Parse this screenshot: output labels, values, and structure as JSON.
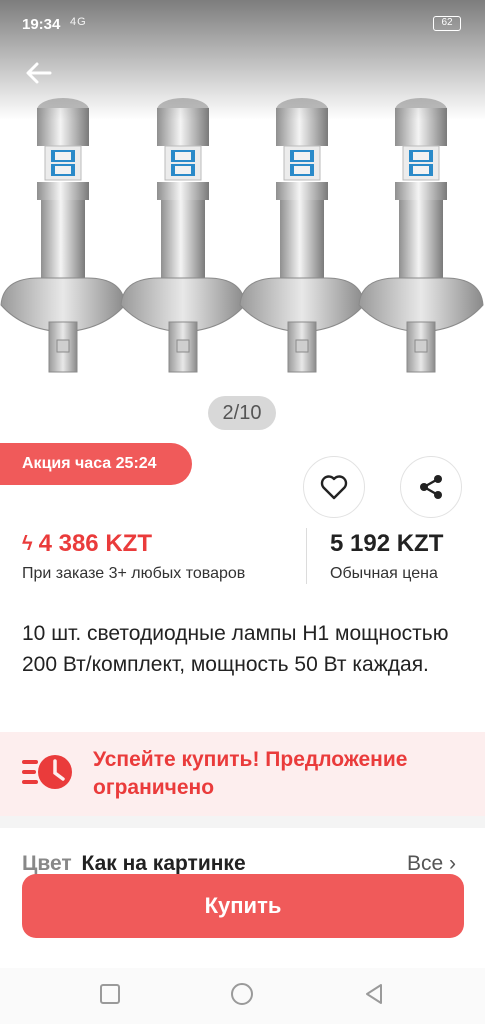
{
  "status_bar": {
    "time": "19:34",
    "signal": "4G",
    "battery": "62"
  },
  "gallery": {
    "page_indicator": "2/10"
  },
  "promo": {
    "badge": "Акция часа 25:24"
  },
  "prices": {
    "promo_price": "4 386 KZT",
    "promo_note": "При заказе 3+ любых товаров",
    "regular_price": "5 192 KZT",
    "regular_note": "Обычная цена"
  },
  "product": {
    "title": "10 шт. светодиодные лампы H1 мощностью 200 Вт/комплект, мощность 50 Вт каждая."
  },
  "urgency": {
    "text": "Успейте купить! Предложение ограничено"
  },
  "options": {
    "color_label": "Цвет",
    "color_value": "Как на картинке",
    "all_label": "Все"
  },
  "actions": {
    "buy_label": "Купить"
  },
  "colors": {
    "accent": "#f05a5a",
    "price_red": "#ea3b3b",
    "urgency_bg": "#fdeeee"
  }
}
